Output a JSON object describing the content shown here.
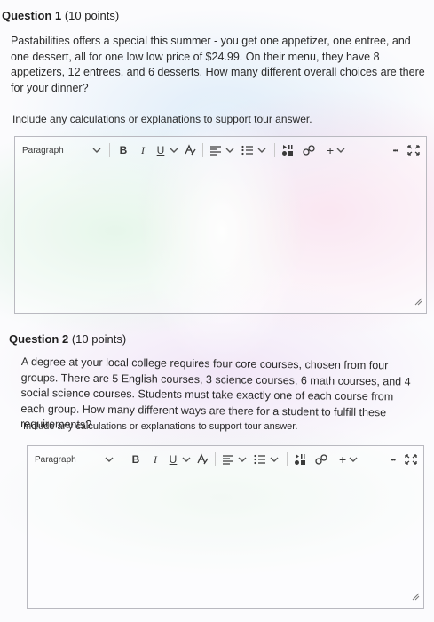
{
  "questions": [
    {
      "number": "Question 1",
      "points": "(10 points)",
      "prompt": "Pastabilities offers a special this summer - you get one appetizer, one entree, and one dessert, all for one low low price of $24.99.  On their menu, they have 8 appetizers, 12 entrees, and 6 desserts.  How many different overall choices are there for your dinner?",
      "instruction": "Include any calculations or explanations to support tour answer.",
      "editor": {
        "format_label": "Paragraph",
        "bold": "B",
        "italic": "I",
        "underline": "U",
        "insert": "+",
        "more": "•••"
      }
    },
    {
      "number": "Question 2",
      "points": "(10 points)",
      "prompt": "A degree at your local college requires four core courses, chosen from four groups.  There are 5 English courses, 3 science courses, 6 math courses, and 4 social science courses.  Students must take exactly one of each course from each group.  How many different ways are there for a student to fulfill these requirements?",
      "instruction": "Include any calculations or explanations to support tour answer.",
      "editor": {
        "format_label": "Paragraph",
        "bold": "B",
        "italic": "I",
        "underline": "U",
        "insert": "+",
        "more": "•••"
      }
    }
  ],
  "icons": {
    "format_chevron": "chevron-down-icon",
    "underline_chevron": "chevron-down-icon",
    "text_color": "text-color-icon",
    "align": "align-left-icon",
    "list": "bulleted-list-icon",
    "media": "insert-media-icon",
    "link": "link-icon",
    "insert_chevron": "chevron-down-icon",
    "fullscreen": "fullscreen-icon",
    "resize": "resize-handle-icon"
  },
  "colors": {
    "text": "#2a2a2a",
    "editor_border": "#b9b9c0",
    "icon": "#3a3a3a"
  }
}
